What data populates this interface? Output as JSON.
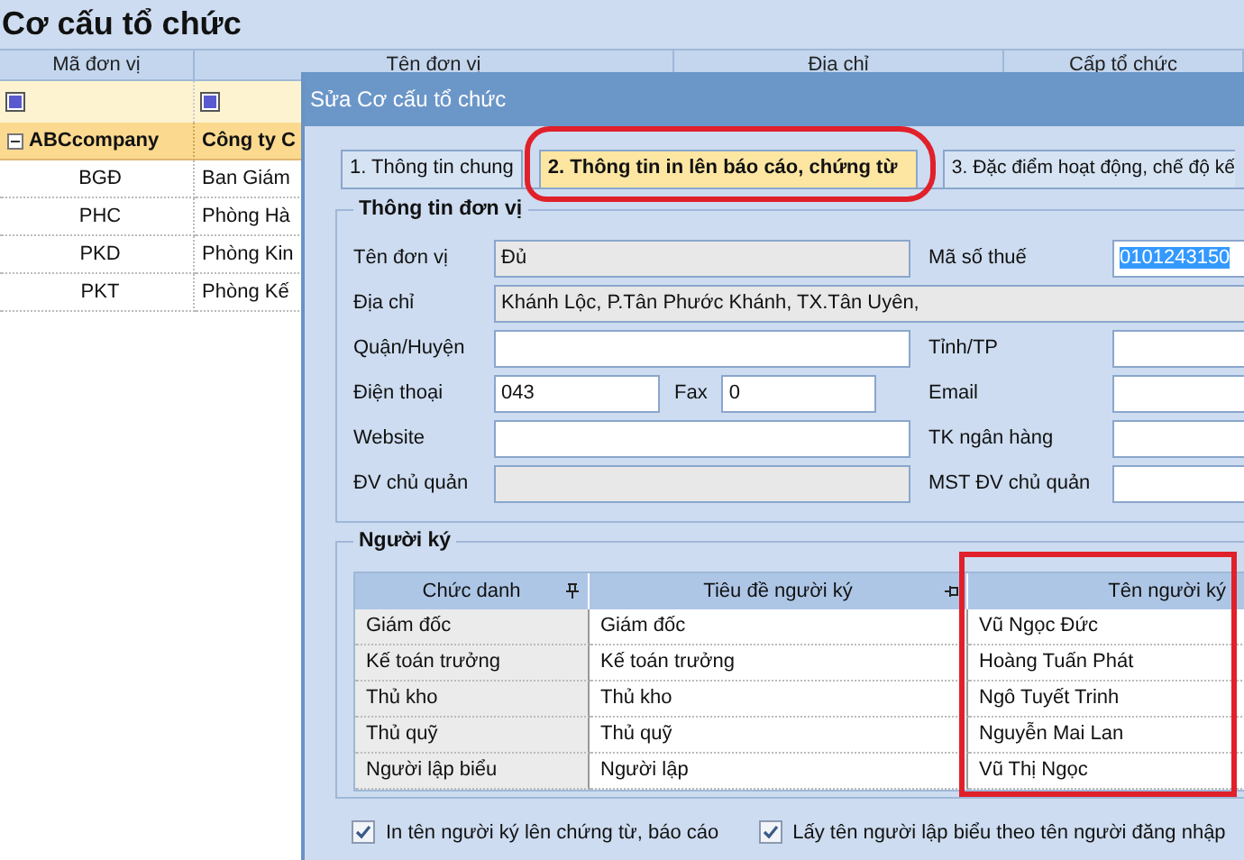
{
  "main_window": {
    "title": "Cơ cấu tổ chức",
    "columns": [
      "Mã đơn vị",
      "Tên đơn vị",
      "Địa chỉ",
      "Cấp tổ chức"
    ],
    "group_row": {
      "code": "ABCcompany",
      "name": "Công ty C",
      "expanded": true
    },
    "rows": [
      {
        "code": "BGĐ",
        "name": "Ban Giám"
      },
      {
        "code": "PHC",
        "name": "Phòng Hà"
      },
      {
        "code": "PKD",
        "name": "Phòng Kin"
      },
      {
        "code": "PKT",
        "name": "Phòng Kế"
      }
    ]
  },
  "dialog": {
    "title": "Sửa Cơ cấu tổ chức",
    "tabs": [
      {
        "label": "1. Thông tin chung",
        "selected": false
      },
      {
        "label": "2. Thông tin in lên báo cáo, chứng từ",
        "selected": true
      },
      {
        "label": "3. Đặc điểm hoạt động, chế độ kế",
        "selected": false
      }
    ],
    "unit_info": {
      "title": "Thông tin đơn vị",
      "rows": [
        {
          "kind": "pair",
          "left": {
            "label": "Tên đơn vị",
            "value": "Đủ",
            "disabled": true
          },
          "right": {
            "label": "Mã số thuế",
            "value": "0101243150",
            "text_selected": true
          }
        },
        {
          "kind": "full",
          "left": {
            "label": "Địa chỉ",
            "value": "Khánh Lộc, P.Tân Phước Khánh, TX.Tân Uyên,",
            "disabled": true
          }
        },
        {
          "kind": "pair",
          "left": {
            "label": "Quận/Huyện"
          },
          "right": {
            "label": "Tỉnh/TP"
          }
        },
        {
          "kind": "phone",
          "left": {
            "label": "Điện thoại",
            "value": "043"
          },
          "fax": {
            "label": "Fax",
            "value": "0"
          },
          "right": {
            "label": "Email"
          }
        },
        {
          "kind": "pair",
          "left": {
            "label": "Website"
          },
          "right": {
            "label": "TK ngân hàng"
          }
        },
        {
          "kind": "pair",
          "left": {
            "label": "ĐV chủ quản",
            "disabled": true
          },
          "right": {
            "label": "MST ĐV chủ quản"
          }
        }
      ]
    },
    "signers": {
      "title": "Người ký",
      "columns": [
        "Chức danh",
        "Tiêu đề người ký",
        "Tên người ký"
      ],
      "rows": [
        [
          "Giám đốc",
          "Giám đốc",
          "Vũ Ngọc Đức"
        ],
        [
          "Kế toán trưởng",
          "Kế toán trưởng",
          "Hoàng Tuấn Phát"
        ],
        [
          "Thủ kho",
          "Thủ kho",
          "Ngô Tuyết Trinh"
        ],
        [
          "Thủ quỹ",
          "Thủ quỹ",
          "Nguyễn Mai Lan"
        ],
        [
          "Người lập biểu",
          "Người lập",
          "Vũ Thị Ngọc"
        ]
      ]
    },
    "options": [
      {
        "label": "In tên người ký lên chứng từ, báo cáo",
        "checked": true
      },
      {
        "label": "Lấy tên người lập biểu theo tên người đăng nhập",
        "checked": true
      }
    ]
  }
}
